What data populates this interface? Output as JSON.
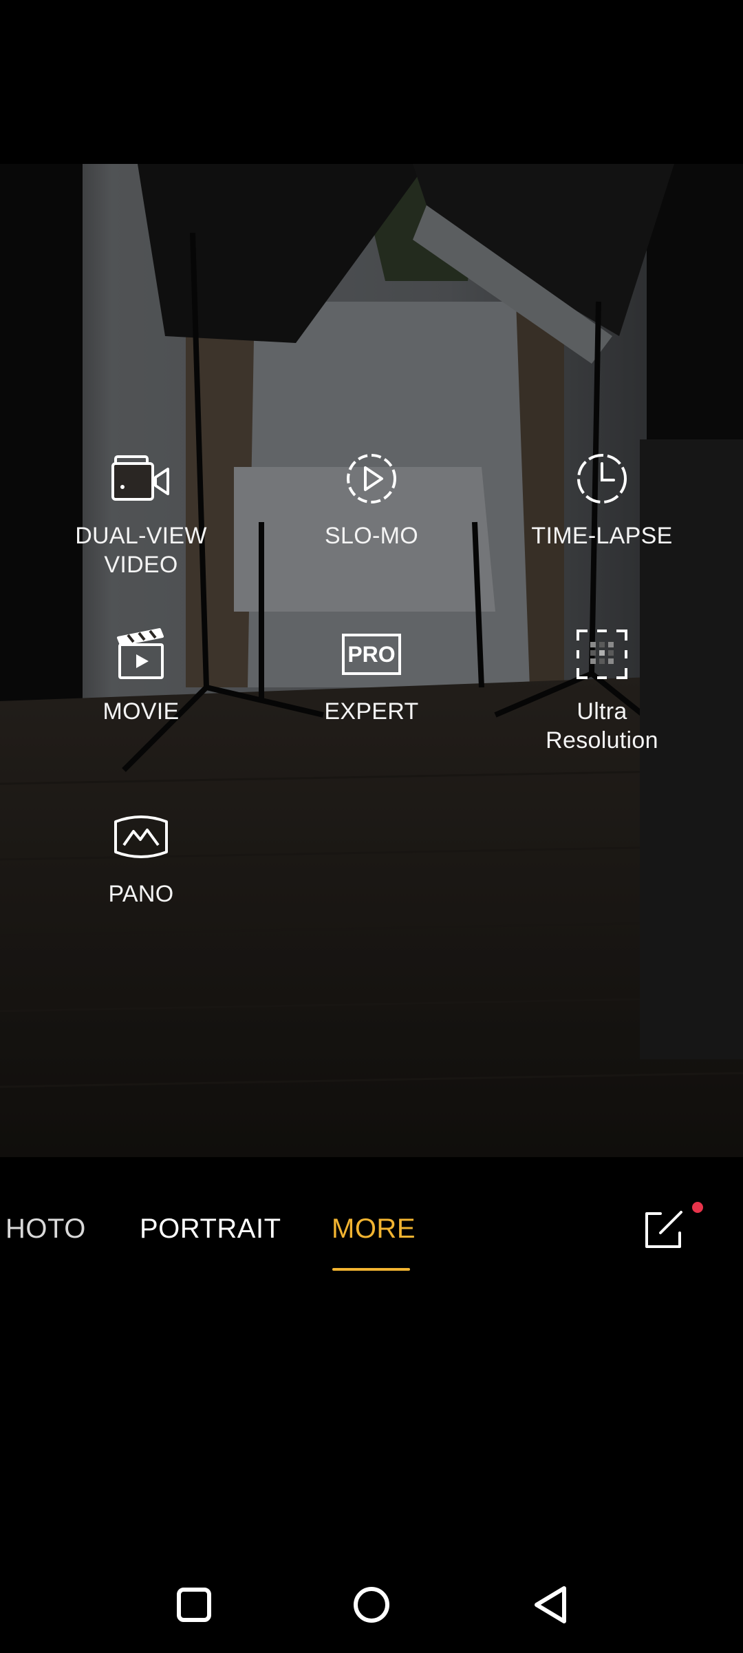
{
  "modes": {
    "dual_view": {
      "label": "DUAL-VIEW\nVIDEO",
      "icon": "dual-view-video-icon"
    },
    "slo_mo": {
      "label": "SLO-MO",
      "icon": "slow-motion-icon"
    },
    "time_lapse": {
      "label": "TIME-LAPSE",
      "icon": "time-lapse-icon"
    },
    "movie": {
      "label": "MOVIE",
      "icon": "movie-clapperboard-icon"
    },
    "expert": {
      "label": "EXPERT",
      "icon": "pro-icon",
      "icon_text": "PRO"
    },
    "ultra_res": {
      "label": "Ultra\nResolution",
      "icon": "ultra-resolution-icon"
    },
    "pano": {
      "label": "PANO",
      "icon": "panorama-icon"
    }
  },
  "mode_bar": {
    "tabs": [
      {
        "label": "HOTO",
        "state": "partial"
      },
      {
        "label": "PORTRAIT",
        "state": "inactive"
      },
      {
        "label": "MORE",
        "state": "active"
      }
    ],
    "edit_icon": "edit-icon",
    "notification_dot_color": "#e8344b"
  },
  "colors": {
    "accent": "#f2b431",
    "background": "#000000"
  },
  "nav": {
    "recents_icon": "square-recents-icon",
    "home_icon": "circle-home-icon",
    "back_icon": "triangle-back-icon"
  }
}
